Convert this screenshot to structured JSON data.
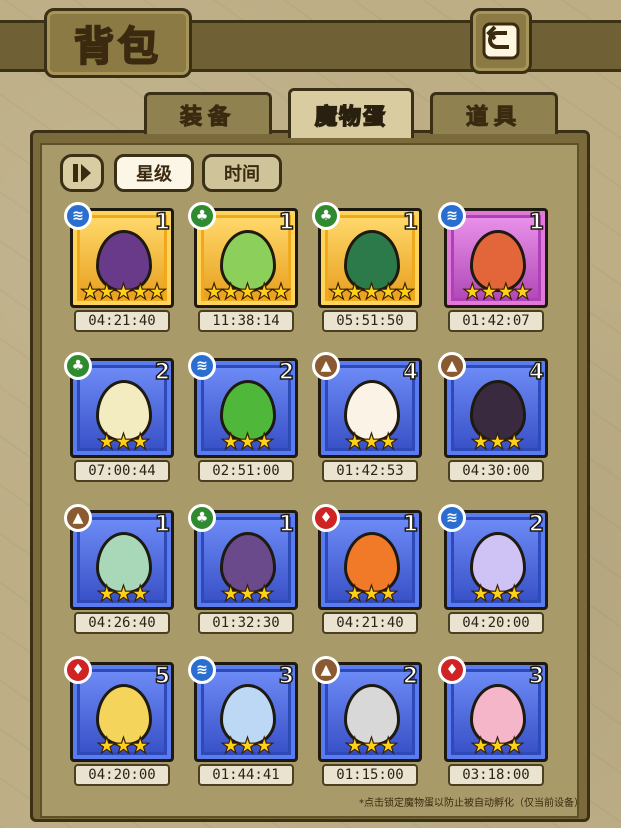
{
  "header": {
    "title": "背包"
  },
  "tabs": [
    {
      "label": "装备",
      "active": false
    },
    {
      "label": "魔物蛋",
      "active": true
    },
    {
      "label": "道具",
      "active": false
    }
  ],
  "sort": {
    "star_label": "星级",
    "time_label": "时间",
    "active": "星级"
  },
  "eggs": [
    {
      "element": "water",
      "count": "1",
      "stars": "★★★★★",
      "timer": "04:21:40",
      "rarity": "gold",
      "color": "#6a3a8a"
    },
    {
      "element": "nature",
      "count": "1",
      "stars": "★★★★★",
      "timer": "11:38:14",
      "rarity": "gold",
      "color": "#8ccf5a"
    },
    {
      "element": "nature",
      "count": "1",
      "stars": "★★★★★",
      "timer": "05:51:50",
      "rarity": "gold",
      "color": "#2c7a4a"
    },
    {
      "element": "water",
      "count": "1",
      "stars": "★★★★",
      "timer": "01:42:07",
      "rarity": "purple",
      "color": "#e2663a"
    },
    {
      "element": "nature",
      "count": "2",
      "stars": "★★★",
      "timer": "07:00:44",
      "rarity": "blue",
      "color": "#f3ecc0"
    },
    {
      "element": "water",
      "count": "2",
      "stars": "★★★",
      "timer": "02:51:00",
      "rarity": "blue",
      "color": "#4fb83a"
    },
    {
      "element": "earth",
      "count": "4",
      "stars": "★★★",
      "timer": "01:42:53",
      "rarity": "blue",
      "color": "#fbf3e6"
    },
    {
      "element": "earth",
      "count": "4",
      "stars": "★★★",
      "timer": "04:30:00",
      "rarity": "blue",
      "color": "#3a2a40"
    },
    {
      "element": "earth",
      "count": "1",
      "stars": "★★★",
      "timer": "04:26:40",
      "rarity": "blue",
      "color": "#a8d8b8"
    },
    {
      "element": "nature",
      "count": "1",
      "stars": "★★★",
      "timer": "01:32:30",
      "rarity": "blue",
      "color": "#6a4a8a"
    },
    {
      "element": "fire",
      "count": "1",
      "stars": "★★★",
      "timer": "04:21:40",
      "rarity": "blue",
      "color": "#f07a28"
    },
    {
      "element": "water",
      "count": "2",
      "stars": "★★★",
      "timer": "04:20:00",
      "rarity": "blue",
      "color": "#cfc2f4"
    },
    {
      "element": "fire",
      "count": "5",
      "stars": "★★★",
      "timer": "04:20:00",
      "rarity": "blue",
      "color": "#f4d45a"
    },
    {
      "element": "water",
      "count": "3",
      "stars": "★★★",
      "timer": "01:44:41",
      "rarity": "blue",
      "color": "#bcd8f4"
    },
    {
      "element": "earth",
      "count": "2",
      "stars": "★★★",
      "timer": "01:15:00",
      "rarity": "blue",
      "color": "#d8d8d8"
    },
    {
      "element": "fire",
      "count": "3",
      "stars": "★★★",
      "timer": "03:18:00",
      "rarity": "blue",
      "color": "#f4b6c8"
    }
  ],
  "footer": {
    "note": "*点击锁定魔物蛋以防止被自动孵化（仅当前设备）"
  },
  "colors": {
    "gold": "#f0a81c",
    "blue": "#2e4ab8",
    "purple": "#b040b8",
    "star": "#ffd21a"
  }
}
